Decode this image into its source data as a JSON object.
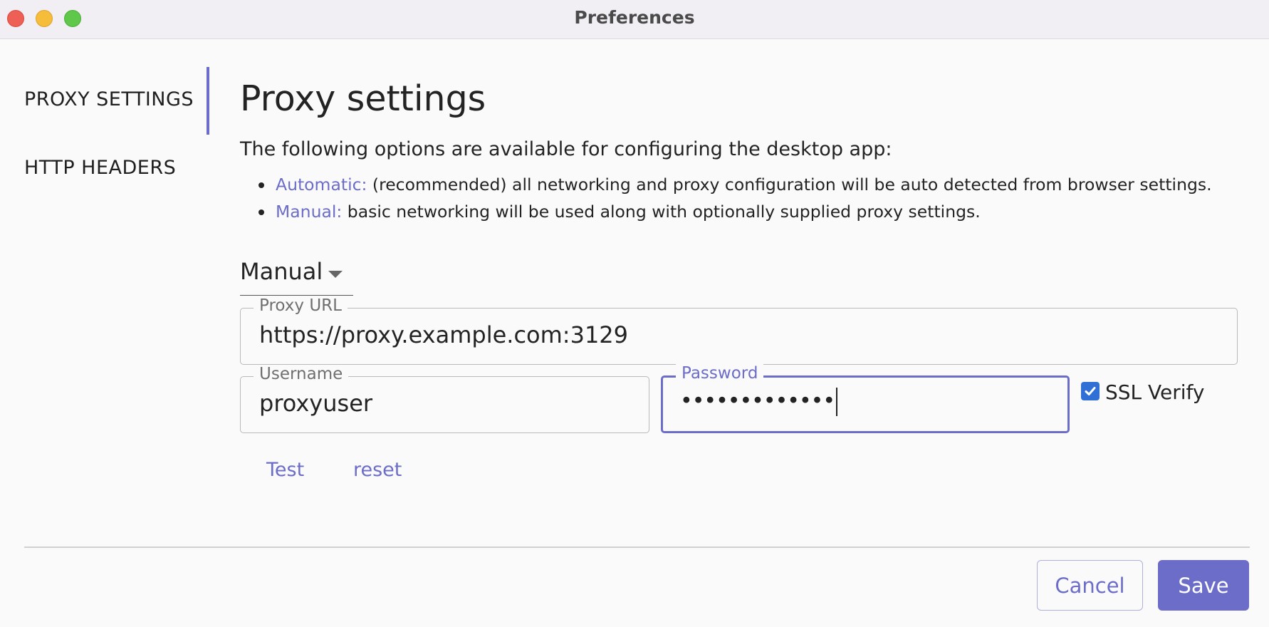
{
  "window": {
    "title": "Preferences"
  },
  "sidebar": {
    "items": [
      {
        "label": "PROXY SETTINGS",
        "active": true
      },
      {
        "label": "HTTP HEADERS",
        "active": false
      }
    ]
  },
  "main": {
    "title": "Proxy settings",
    "intro": "The following options are available for configuring the desktop app:",
    "options": [
      {
        "name": "Automatic:",
        "description": " (recommended) all networking and proxy configuration will be auto detected from browser settings."
      },
      {
        "name": "Manual:",
        "description": " basic networking will be used along with optionally supplied proxy settings."
      }
    ],
    "mode": {
      "selected": "Manual"
    },
    "proxy_url": {
      "label": "Proxy URL",
      "value": "https://proxy.example.com:3129"
    },
    "username": {
      "label": "Username",
      "value": "proxyuser"
    },
    "password": {
      "label": "Password",
      "masked_value": "•••••••••••••"
    },
    "ssl_verify": {
      "label": "SSL Verify",
      "checked": true
    },
    "actions": {
      "test_label": "Test",
      "reset_label": "reset"
    }
  },
  "footer": {
    "cancel_label": "Cancel",
    "save_label": "Save"
  },
  "colors": {
    "accent": "#6c6dc8",
    "checkbox": "#2f6fd6",
    "close": "#ee5f56",
    "minimize": "#f6bd3b",
    "maximize": "#5fc84a"
  }
}
